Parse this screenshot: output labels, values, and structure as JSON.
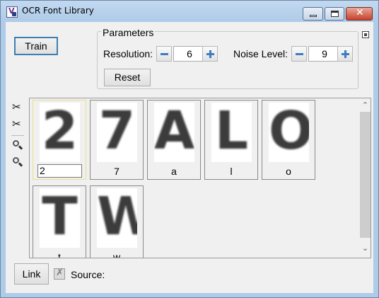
{
  "window": {
    "title": "OCR Font Library"
  },
  "toolbar": {
    "train_label": "Train"
  },
  "parameters": {
    "legend": "Parameters",
    "resolution_label": "Resolution:",
    "resolution_value": "6",
    "noise_label": "Noise Level:",
    "noise_value": "9",
    "reset_label": "Reset"
  },
  "tools": [
    "scissors-icon",
    "scissors-copy-icon",
    "zoom-in-icon",
    "zoom-out-icon"
  ],
  "glyphs": [
    {
      "image": "2",
      "label": "2",
      "selected": true
    },
    {
      "image": "7",
      "label": "7"
    },
    {
      "image": "A",
      "label": "a"
    },
    {
      "image": "L",
      "label": "l"
    },
    {
      "image": "O",
      "label": "o"
    },
    {
      "image": "T",
      "label": "t"
    },
    {
      "image": "W",
      "label": "w"
    }
  ],
  "footer": {
    "link_label": "Link",
    "source_label": "Source:"
  }
}
